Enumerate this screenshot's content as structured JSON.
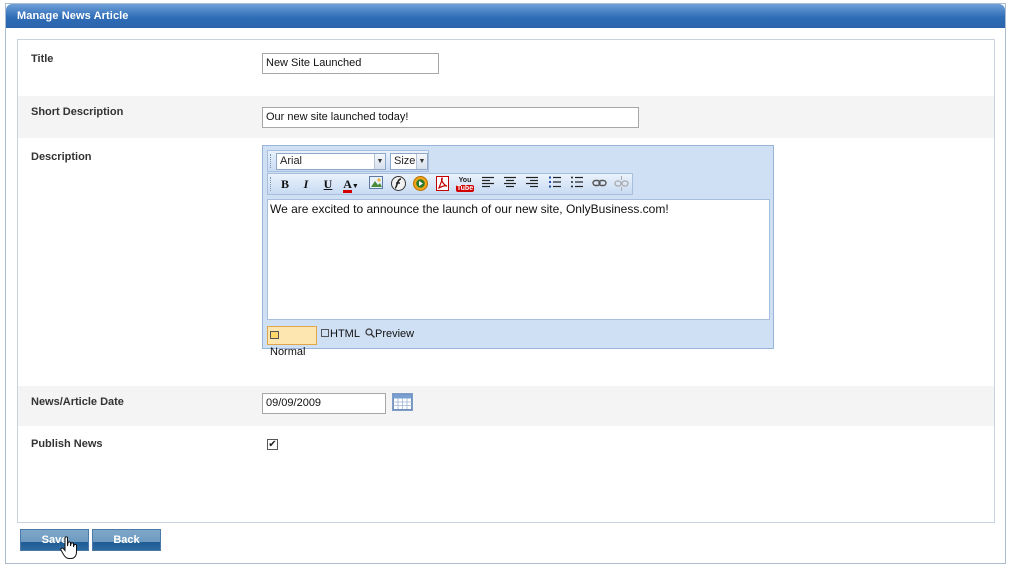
{
  "panel": {
    "title": "Manage News Article"
  },
  "fields": {
    "title": {
      "label": "Title",
      "value": "New Site Launched"
    },
    "short_description": {
      "label": "Short Description",
      "value": "Our new site launched today!"
    },
    "description": {
      "label": "Description"
    },
    "date": {
      "label": "News/Article Date",
      "value": "09/09/2009"
    },
    "publish": {
      "label": "Publish News",
      "checked": true,
      "check_glyph": "✔"
    }
  },
  "editor": {
    "font": "Arial",
    "size": "Size",
    "content": "We are excited to announce the launch of our new site, OnlyBusiness.com!",
    "toolbar": {
      "bold": "B",
      "italic": "I",
      "underline": "U",
      "font_color": "A",
      "youtube_top": "You",
      "youtube_bottom": "Tube"
    },
    "modes": {
      "normal": "Normal",
      "html": "HTML",
      "preview": "Preview"
    }
  },
  "buttons": {
    "save": "Save",
    "back": "Back"
  },
  "colors": {
    "title_bar": "#2f6db7",
    "button": "#6f9bc1",
    "editor_bg": "#cfe0f5"
  }
}
